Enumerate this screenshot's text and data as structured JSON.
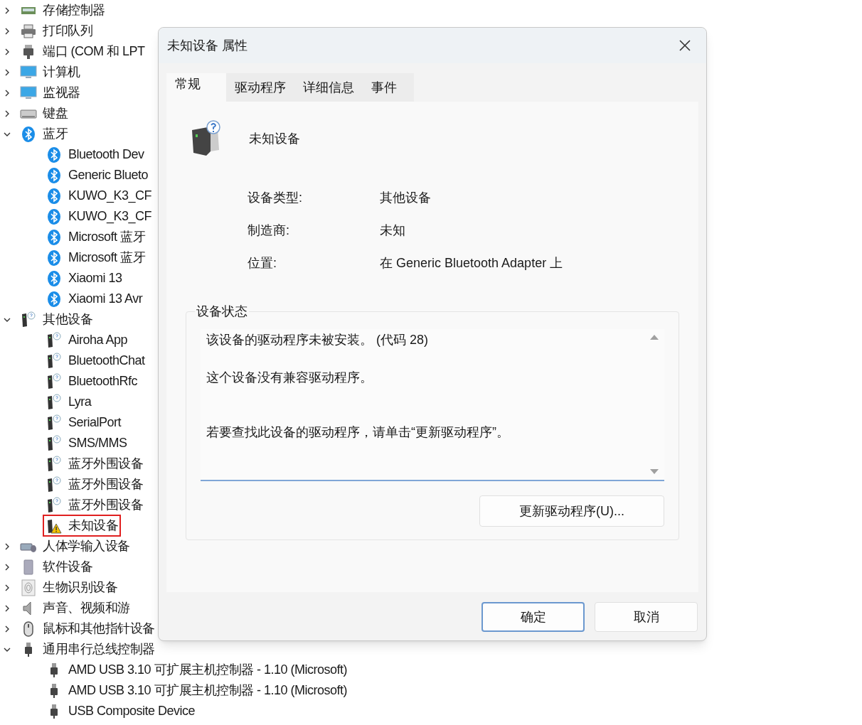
{
  "device_tree": [
    {
      "label": "存储控制器",
      "kind": "storage",
      "expanded": false
    },
    {
      "label": "打印队列",
      "kind": "printer",
      "expanded": false
    },
    {
      "label": "端口 (COM 和 LPT",
      "kind": "port",
      "expanded": false
    },
    {
      "label": "计算机",
      "kind": "computer",
      "expanded": false
    },
    {
      "label": "监视器",
      "kind": "monitor",
      "expanded": false
    },
    {
      "label": "键盘",
      "kind": "keyboard",
      "expanded": false
    },
    {
      "label": "蓝牙",
      "kind": "bluetooth",
      "expanded": true,
      "children": [
        {
          "label": "Bluetooth Dev",
          "kind": "bluetooth"
        },
        {
          "label": "Generic Blueto",
          "kind": "bluetooth"
        },
        {
          "label": "KUWO_K3_CF",
          "kind": "bluetooth"
        },
        {
          "label": "KUWO_K3_CF",
          "kind": "bluetooth"
        },
        {
          "label": "Microsoft 蓝牙",
          "kind": "bluetooth"
        },
        {
          "label": "Microsoft 蓝牙",
          "kind": "bluetooth"
        },
        {
          "label": "Xiaomi 13",
          "kind": "bluetooth"
        },
        {
          "label": "Xiaomi 13 Avr",
          "kind": "bluetooth"
        }
      ]
    },
    {
      "label": "其他设备",
      "kind": "other",
      "expanded": true,
      "children": [
        {
          "label": "Airoha App",
          "kind": "other"
        },
        {
          "label": "BluetoothChat",
          "kind": "other"
        },
        {
          "label": "BluetoothRfc",
          "kind": "other"
        },
        {
          "label": "Lyra",
          "kind": "other"
        },
        {
          "label": "SerialPort",
          "kind": "other"
        },
        {
          "label": "SMS/MMS",
          "kind": "other"
        },
        {
          "label": "蓝牙外围设备",
          "kind": "other"
        },
        {
          "label": "蓝牙外围设备",
          "kind": "other"
        },
        {
          "label": "蓝牙外围设备",
          "kind": "other"
        },
        {
          "label": "未知设备",
          "kind": "warning",
          "highlighted": true
        }
      ]
    },
    {
      "label": "人体学输入设备",
      "kind": "hid",
      "expanded": false
    },
    {
      "label": "软件设备",
      "kind": "software",
      "expanded": false
    },
    {
      "label": "生物识别设备",
      "kind": "biometric",
      "expanded": false
    },
    {
      "label": "声音、视频和游",
      "kind": "sound",
      "expanded": false
    },
    {
      "label": "鼠标和其他指针设备",
      "kind": "mouse",
      "expanded": false
    },
    {
      "label": "通用串行总线控制器",
      "kind": "usb",
      "expanded": true,
      "children": [
        {
          "label": "AMD USB 3.10 可扩展主机控制器 - 1.10 (Microsoft)",
          "kind": "usb"
        },
        {
          "label": "AMD USB 3.10 可扩展主机控制器 - 1.10 (Microsoft)",
          "kind": "usb"
        },
        {
          "label": "USB Composite Device",
          "kind": "usb"
        }
      ]
    }
  ],
  "dialog": {
    "title": "未知设备 属性",
    "tabs": [
      {
        "label": "常规",
        "selected": true
      },
      {
        "label": "驱动程序",
        "selected": false
      },
      {
        "label": "详细信息",
        "selected": false
      },
      {
        "label": "事件",
        "selected": false
      }
    ],
    "device_name": "未知设备",
    "properties": [
      {
        "label": "设备类型:",
        "value": "其他设备"
      },
      {
        "label": "制造商:",
        "value": "未知"
      },
      {
        "label": "位置:",
        "value": "在 Generic Bluetooth Adapter 上"
      }
    ],
    "status_group": "设备状态",
    "status_lines": [
      "该设备的驱动程序未被安装。 (代码 28)",
      "这个设备没有兼容驱动程序。",
      "若要查找此设备的驱动程序，请单击“更新驱动程序”。"
    ],
    "update_button": "更新驱动程序(U)...",
    "buttons": [
      {
        "label": "确定",
        "focused": true
      },
      {
        "label": "取消",
        "focused": false
      }
    ]
  }
}
